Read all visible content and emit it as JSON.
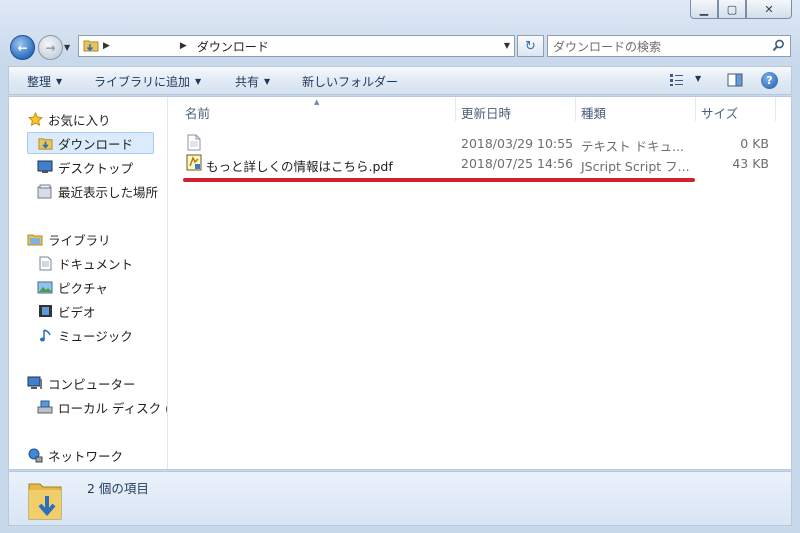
{
  "window": {
    "controls": [
      "minimize",
      "maximize",
      "close"
    ]
  },
  "address_bar": {
    "breadcrumb": [
      "",
      "ダウンロード"
    ]
  },
  "search": {
    "placeholder": "ダウンロードの検索"
  },
  "toolbar": {
    "organize": "整理",
    "add_to_library": "ライブラリに追加",
    "share": "共有",
    "new_folder": "新しいフォルダー"
  },
  "nav": {
    "favorites": {
      "label": "お気に入り",
      "items": [
        "ダウンロード",
        "デスクトップ",
        "最近表示した場所"
      ]
    },
    "libraries": {
      "label": "ライブラリ",
      "items": [
        "ドキュメント",
        "ピクチャ",
        "ビデオ",
        "ミュージック"
      ]
    },
    "computer": {
      "label": "コンピューター",
      "items": [
        "ローカル ディスク ("
      ]
    },
    "network": {
      "label": "ネットワーク"
    }
  },
  "columns": {
    "name": "名前",
    "modified": "更新日時",
    "type": "種類",
    "size": "サイズ"
  },
  "files": [
    {
      "name": "",
      "modified": "2018/03/29 10:55",
      "type": "テキスト ドキュ...",
      "size": "0 KB",
      "icon": "text-file-icon"
    },
    {
      "name": "もっと詳しくの情報はこちら.pdf",
      "modified": "2018/07/25 14:56",
      "type": "JScript Script フ...",
      "size": "43 KB",
      "icon": "script-file-icon"
    }
  ],
  "annotation": {
    "color": "#d2202e"
  },
  "details": {
    "item_count": "2 個の項目"
  }
}
